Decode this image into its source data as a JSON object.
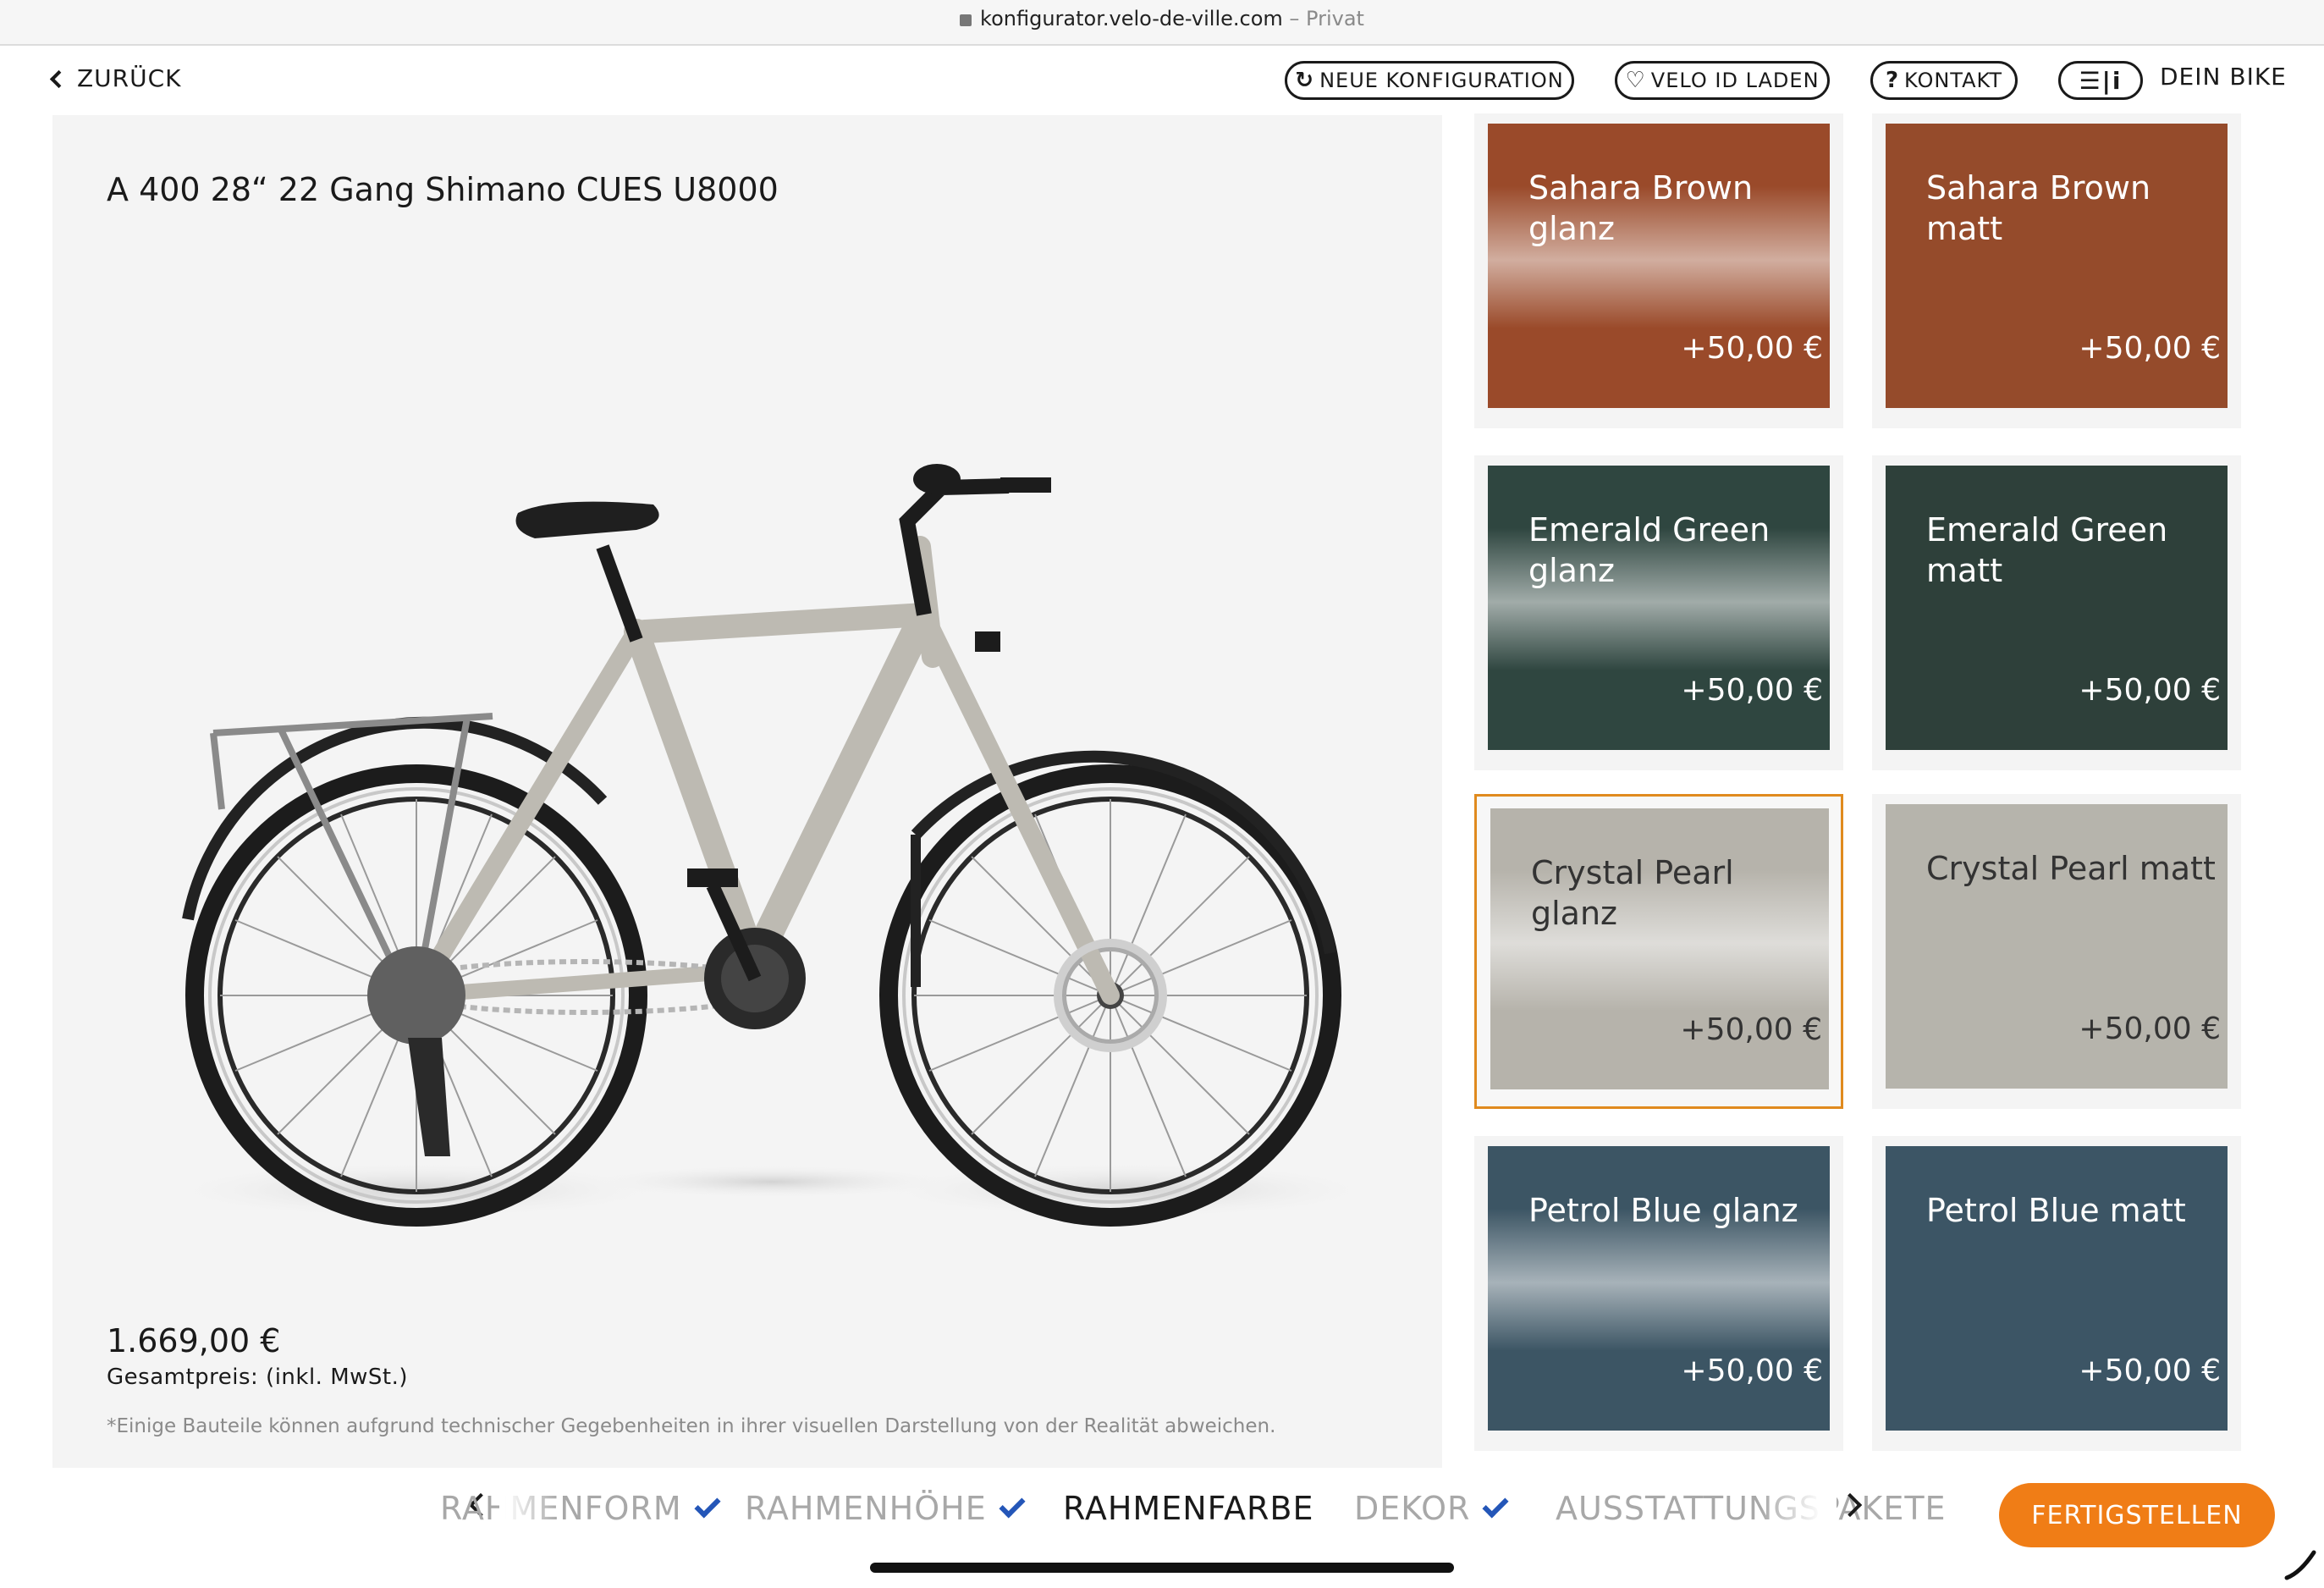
{
  "browser": {
    "domain": "konfigurator.velo-de-ville.com",
    "mode": " – Privat"
  },
  "header": {
    "back_label": "ZURÜCK",
    "new_config_label": "NEUE KONFIGURATION",
    "velo_id_label": "VELO ID LADEN",
    "contact_label": "KONTAKT",
    "menu_icon_text": "☰|i",
    "my_bike_label": "DEIN BIKE"
  },
  "product": {
    "title": "A 400 28“ 22 Gang Shimano CUES U8000",
    "price": "1.669,00 €",
    "price_label": "Gesamtpreis: (inkl. MwSt.)",
    "disclaimer": "*Einige Bauteile können aufgrund technischer Gegebenheiten in ihrer visuellen Darstellung von der Realität abweichen.",
    "frame_color": "#bdbab2"
  },
  "colors": [
    {
      "name": "Sahara Brown glanz",
      "price": "+50,00 €",
      "hex": "#9a4a2a",
      "finish": "glanz",
      "selected": false
    },
    {
      "name": "Sahara Brown matt",
      "price": "+50,00 €",
      "hex": "#954b2b",
      "finish": "matt",
      "selected": false
    },
    {
      "name": "Emerald Green glanz",
      "price": "+50,00 €",
      "hex": "#2f4640",
      "finish": "glanz",
      "selected": false
    },
    {
      "name": "Emerald Green matt",
      "price": "+50,00 €",
      "hex": "#2e403a",
      "finish": "matt",
      "selected": false
    },
    {
      "name": "Crystal Pearl glanz",
      "price": "+50,00 €",
      "hex": "#b6b3ab",
      "finish": "glanz",
      "selected": true
    },
    {
      "name": "Crystal Pearl matt",
      "price": "+50,00 €",
      "hex": "#b6b4ac",
      "finish": "matt",
      "selected": false
    },
    {
      "name": "Petrol Blue glanz",
      "price": "+50,00 €",
      "hex": "#3c5564",
      "finish": "glanz",
      "selected": false
    },
    {
      "name": "Petrol Blue matt",
      "price": "+50,00 €",
      "hex": "#3c5565",
      "finish": "matt",
      "selected": false
    }
  ],
  "steps": [
    {
      "label": "RAHMENFORM",
      "display": "RAHMENFORM",
      "done": true
    },
    {
      "label": "RAHMENHÖHE",
      "display": "RAHMENHÖHE",
      "done": true
    },
    {
      "label": "RAHMENFARBE",
      "display": "RAHMENFARBE",
      "done": false,
      "active": true
    },
    {
      "label": "DEKOR",
      "display": "DEKOR",
      "done": true
    },
    {
      "label": "AUSSTATTUNGSPAKETE",
      "display": "AUSSTATTUNGSPAKETE",
      "done": false
    }
  ],
  "actions": {
    "finish_label": "FERTIGSTELLEN"
  },
  "theme": {
    "accent": "#f07d16",
    "selected_border": "#e08a1e",
    "check": "#2456b8"
  }
}
